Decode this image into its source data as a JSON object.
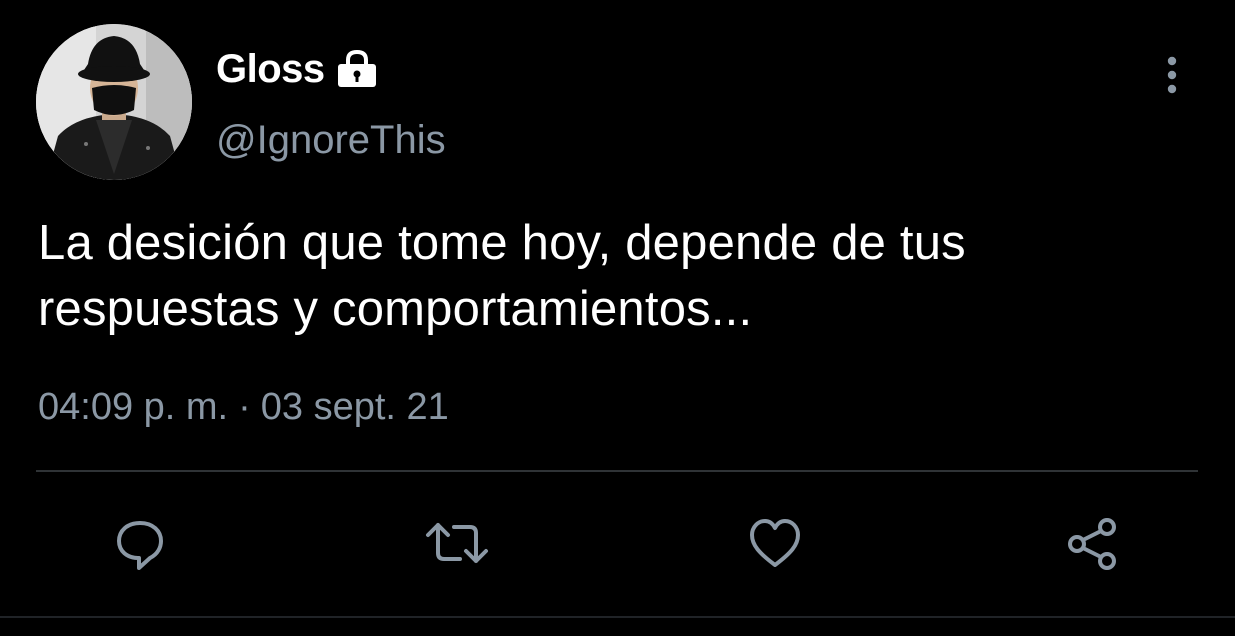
{
  "user": {
    "display_name": "Gloss",
    "handle": "@IgnoreThis",
    "protected_icon": "lock-icon",
    "avatar_icon": "avatar-photo"
  },
  "tweet": {
    "text_line1": "La desición que tome hoy, depende de tus",
    "text_line2": "respuestas y comportamientos...",
    "time": "04:09 p. m.",
    "separator": "·",
    "date": "03 sept. 21"
  },
  "actions": [
    {
      "name": "reply",
      "icon": "comment-icon"
    },
    {
      "name": "retweet",
      "icon": "retweet-icon"
    },
    {
      "name": "like",
      "icon": "heart-icon"
    },
    {
      "name": "share",
      "icon": "share-icon"
    }
  ],
  "menu": {
    "icon": "more-vertical-icon"
  },
  "colors": {
    "background": "#000000",
    "primary_text": "#ffffff",
    "secondary_text": "#8b98a5",
    "divider": "#2f3336"
  }
}
